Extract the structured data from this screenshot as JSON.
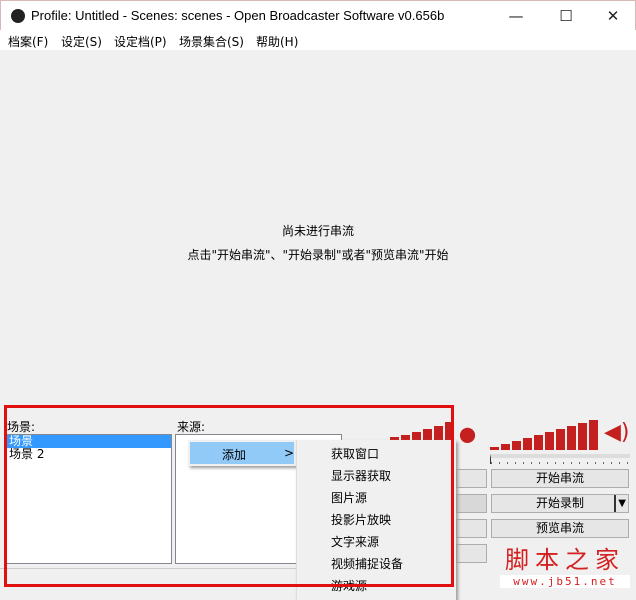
{
  "window": {
    "title": "Profile: Untitled - Scenes: scenes - Open Broadcaster Software v0.656b",
    "minimize": "—",
    "maximize": "☐",
    "close": "✕"
  },
  "menu": [
    "档案(F)",
    "设定(S)",
    "设定档(P)",
    "场景集合(S)",
    "帮助(H)"
  ],
  "preview": {
    "line1": "尚未进行串流",
    "line2": "点击\"开始串流\"、\"开始录制\"或者\"预览串流\"开始"
  },
  "scenes": {
    "label": "场景:",
    "items": [
      "场景",
      "场景 2"
    ]
  },
  "sources": {
    "label": "来源:"
  },
  "context_menu": {
    "item": "添加",
    "arrow": ">"
  },
  "submenu": [
    "获取窗口",
    "显示器获取",
    "图片源",
    "投影片放映",
    "文字来源",
    "视频捕捉设备",
    "游戏源"
  ],
  "buttons": {
    "start_stream": "开始串流",
    "start_record": "开始录制",
    "preview_stream": "预览串流"
  },
  "watermark": {
    "title": "脚本之家",
    "url": "www.jb51.net"
  },
  "colors": {
    "meter": "#c42020",
    "highlight": "#3399ff",
    "annotation": "#e01010"
  }
}
